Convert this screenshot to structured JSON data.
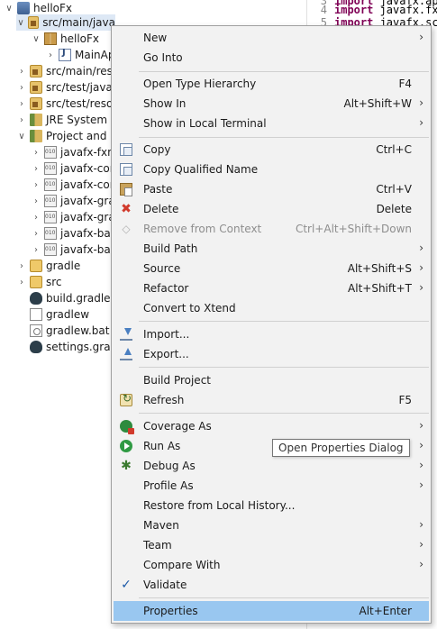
{
  "tree": {
    "items": [
      {
        "label": "helloFx",
        "icon": "project-icon",
        "twisty": "expanded"
      },
      {
        "label": "src/main/java",
        "icon": "source-folder-icon",
        "twisty": "expanded",
        "selected": true
      },
      {
        "label": "helloFx",
        "icon": "package-icon",
        "twisty": "expanded"
      },
      {
        "label": "MainAp",
        "icon": "java-file-icon",
        "twisty": "collapsed"
      },
      {
        "label": "src/main/reso",
        "icon": "source-folder-icon",
        "twisty": "collapsed"
      },
      {
        "label": "src/test/java",
        "icon": "source-folder-icon",
        "twisty": "collapsed"
      },
      {
        "label": "src/test/resou",
        "icon": "source-folder-icon",
        "twisty": "collapsed"
      },
      {
        "label": "JRE System L",
        "icon": "library-icon",
        "twisty": "collapsed"
      },
      {
        "label": "Project and E",
        "icon": "library-icon",
        "twisty": "expanded"
      },
      {
        "label": "javafx-fxm",
        "icon": "jar-icon",
        "twisty": "collapsed"
      },
      {
        "label": "javafx-con",
        "icon": "jar-icon",
        "twisty": "collapsed"
      },
      {
        "label": "javafx-con",
        "icon": "jar-icon",
        "twisty": "collapsed"
      },
      {
        "label": "javafx-gra",
        "icon": "jar-icon",
        "twisty": "collapsed"
      },
      {
        "label": "javafx-gra",
        "icon": "jar-icon",
        "twisty": "collapsed"
      },
      {
        "label": "javafx-bas",
        "icon": "jar-icon",
        "twisty": "collapsed"
      },
      {
        "label": "javafx-bas",
        "icon": "jar-icon",
        "twisty": "collapsed"
      },
      {
        "label": "gradle",
        "icon": "folder-icon",
        "twisty": "collapsed"
      },
      {
        "label": "src",
        "icon": "folder-icon",
        "twisty": "collapsed"
      },
      {
        "label": "build.gradle",
        "icon": "gradle-icon",
        "twisty": ""
      },
      {
        "label": "gradlew",
        "icon": "file-icon",
        "twisty": ""
      },
      {
        "label": "gradlew.bat",
        "icon": "batch-file-icon",
        "twisty": ""
      },
      {
        "label": "settings.gradl",
        "icon": "gradle-icon",
        "twisty": ""
      }
    ]
  },
  "editor": {
    "lines": [
      {
        "num": "3",
        "keyword": "import",
        "rest": " javafx.appl"
      },
      {
        "num": "4",
        "keyword": "import",
        "rest": " javafx.fxml"
      },
      {
        "num": "5",
        "keyword": "import",
        "rest": " javafx.scen"
      }
    ]
  },
  "menu": {
    "items": [
      {
        "label": "New",
        "accel": "",
        "submenu": true
      },
      {
        "label": "Go Into",
        "accel": "",
        "submenu": false
      },
      {
        "label": "Open Type Hierarchy",
        "accel": "F4",
        "submenu": false
      },
      {
        "label": "Show In",
        "accel": "Alt+Shift+W",
        "submenu": true
      },
      {
        "label": "Show in Local Terminal",
        "accel": "",
        "submenu": true
      },
      {
        "label": "Copy",
        "accel": "Ctrl+C",
        "icon": "copy-icon"
      },
      {
        "label": "Copy Qualified Name",
        "accel": "",
        "icon": "copy-qualified-name-icon"
      },
      {
        "label": "Paste",
        "accel": "Ctrl+V",
        "icon": "paste-icon"
      },
      {
        "label": "Delete",
        "accel": "Delete",
        "icon": "delete-icon"
      },
      {
        "label": "Remove from Context",
        "accel": "Ctrl+Alt+Shift+Down",
        "disabled": true,
        "icon": "remove-context-icon"
      },
      {
        "label": "Build Path",
        "accel": "",
        "submenu": true
      },
      {
        "label": "Source",
        "accel": "Alt+Shift+S",
        "submenu": true
      },
      {
        "label": "Refactor",
        "accel": "Alt+Shift+T",
        "submenu": true
      },
      {
        "label": "Convert to Xtend",
        "accel": ""
      },
      {
        "label": "Import...",
        "accel": "",
        "icon": "import-icon"
      },
      {
        "label": "Export...",
        "accel": "",
        "icon": "export-icon"
      },
      {
        "label": "Build Project",
        "accel": ""
      },
      {
        "label": "Refresh",
        "accel": "F5",
        "icon": "refresh-icon"
      },
      {
        "label": "Coverage As",
        "accel": "",
        "submenu": true,
        "icon": "coverage-icon"
      },
      {
        "label": "Run As",
        "accel": "",
        "submenu": true,
        "icon": "run-icon"
      },
      {
        "label": "Debug As",
        "accel": "",
        "submenu": true,
        "icon": "debug-icon"
      },
      {
        "label": "Profile As",
        "accel": "",
        "submenu": true
      },
      {
        "label": "Restore from Local History...",
        "accel": ""
      },
      {
        "label": "Maven",
        "accel": "",
        "submenu": true
      },
      {
        "label": "Team",
        "accel": "",
        "submenu": true
      },
      {
        "label": "Compare With",
        "accel": "",
        "submenu": true
      },
      {
        "label": "Validate",
        "accel": "",
        "icon": "checkmark-icon"
      },
      {
        "label": "Properties",
        "accel": "Alt+Enter",
        "highlighted": true
      }
    ],
    "submenu_arrow": "›"
  },
  "tooltip": {
    "text": "Open Properties Dialog"
  },
  "colors": {
    "highlight": "#99c7f0",
    "selection": "#dde8f5",
    "menu_bg": "#f2f2f2"
  }
}
